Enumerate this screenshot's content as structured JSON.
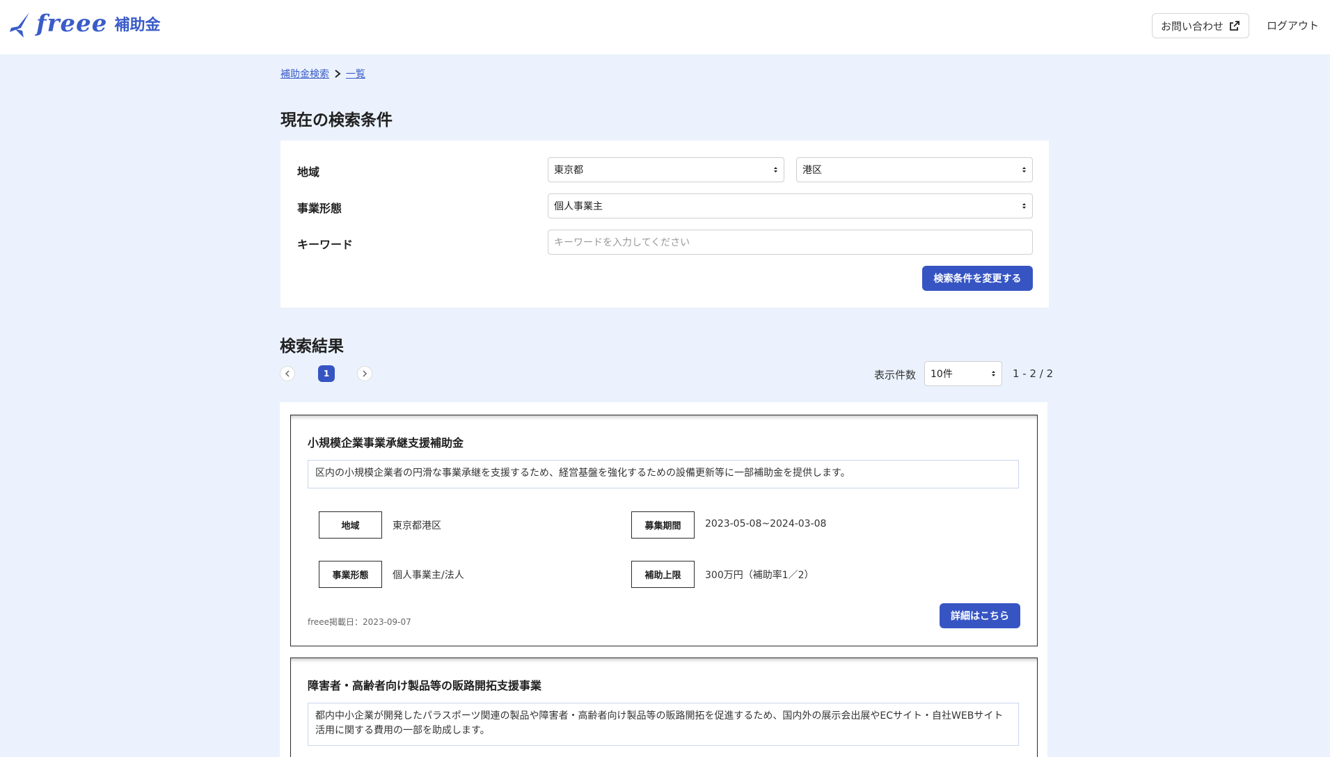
{
  "header": {
    "logo_text": "freee",
    "logo_sub": "補助金",
    "contact_label": "お問い合わせ",
    "logout_label": "ログアウト"
  },
  "breadcrumb": {
    "items": [
      "補助金検索",
      "一覧"
    ]
  },
  "conditions": {
    "title": "現在の検索条件",
    "region_label": "地域",
    "prefecture_value": "東京都",
    "city_value": "港区",
    "business_type_label": "事業形態",
    "business_type_value": "個人事業主",
    "keyword_label": "キーワード",
    "keyword_placeholder": "キーワードを入力してください",
    "keyword_value": "",
    "submit_label": "検索条件を変更する"
  },
  "results": {
    "title": "検索結果",
    "pagination": {
      "current_page": "1"
    },
    "per_page_label": "表示件数",
    "per_page_value": "10件",
    "range_text": "1 - 2 / 2",
    "cards": [
      {
        "title": "小規模企業事業承継支援補助金",
        "description": "区内の小規模企業者の円滑な事業承継を支援するため、経営基盤を強化するための設備更新等に一部補助金を提供します。",
        "region_label": "地域",
        "region_value": "東京都港区",
        "period_label": "募集期間",
        "period_value": "2023-05-08~2024-03-08",
        "business_type_label": "事業形態",
        "business_type_value": "個人事業主/法人",
        "limit_label": "補助上限",
        "limit_value": "300万円（補助率1／2）",
        "posted_text": "freee掲載日：2023-09-07",
        "detail_label": "詳細はこちら"
      },
      {
        "title": "障害者・高齢者向け製品等の販路開拓支援事業",
        "description": "都内中小企業が開発したパラスポーツ関連の製品や障害者・高齢者向け製品等の販路開拓を促進するため、国内外の展示会出展やECサイト・自社WEBサイト活用に関する費用の一部を助成します。"
      }
    ]
  },
  "colors": {
    "brand": "#3a5cc9",
    "primary_button": "#3655c3",
    "page_background": "#ebf2fd"
  }
}
